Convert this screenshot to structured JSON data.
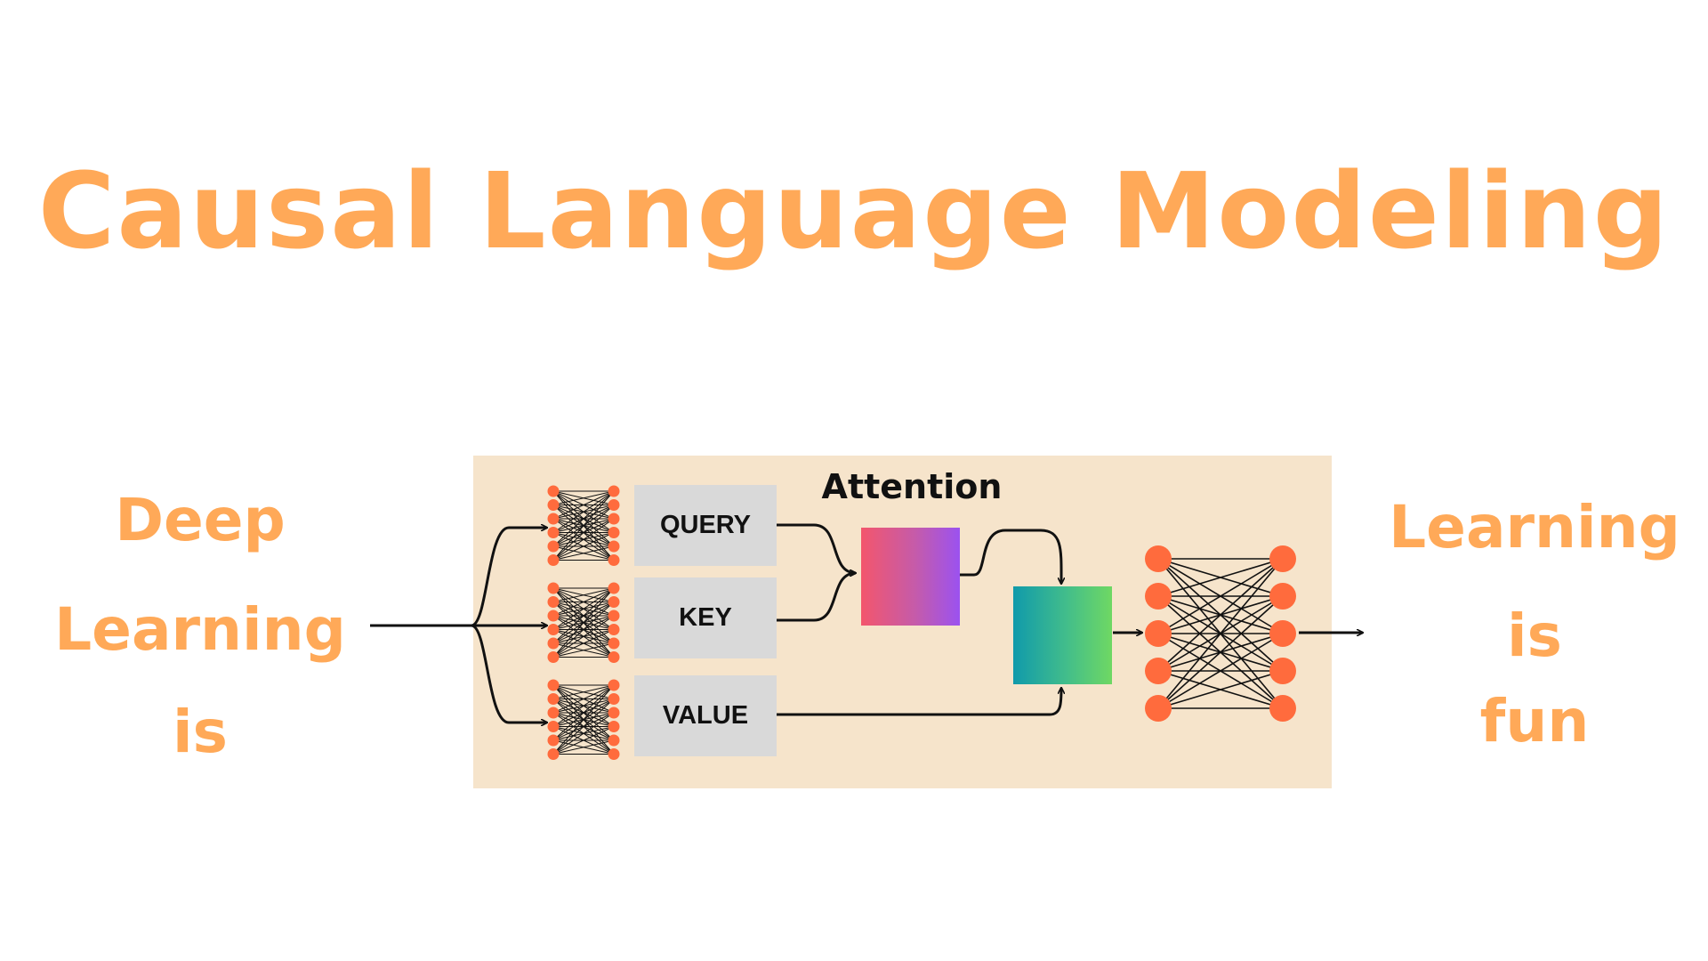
{
  "title": "Causal Language Modeling",
  "input_words": [
    "Deep",
    "Learning",
    "is"
  ],
  "output_words": [
    "Learning",
    "is",
    "fun"
  ],
  "projections": {
    "query_label": "QUERY",
    "key_label": "KEY",
    "value_label": "VALUE"
  },
  "attention_label": "Attention",
  "colors": {
    "title": "#ffa958",
    "panel_background": "#f6e4cb",
    "projection_box": "#d9d9d9",
    "neuron": "#ff6b3d",
    "attention_gradient": [
      "#f3566c",
      "#9b52f0"
    ],
    "mix_gradient": [
      "#109aab",
      "#6fd863"
    ]
  },
  "icons": {
    "small_network": "fully-connected-network-icon",
    "output_network": "feedforward-network-icon"
  }
}
